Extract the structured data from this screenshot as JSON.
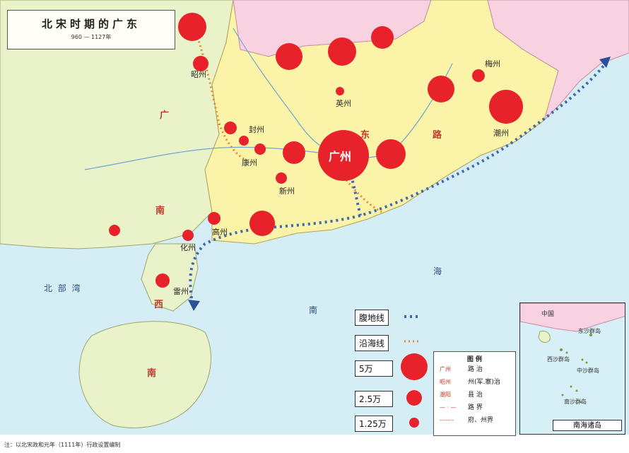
{
  "title": {
    "main": "北宋时期的广东",
    "sub": "960 — 1127年"
  },
  "note": "注：以北宋政和元年（1111年）行政设置编制",
  "keys": {
    "fudi": "腹地线",
    "yanhai": "沿海线",
    "v5": "5万",
    "v25": "2.5万",
    "v125": "1.25万"
  },
  "legend": {
    "header": "图 例",
    "rows": [
      {
        "sym": "广州",
        "label": "路 治"
      },
      {
        "sym": "昭州",
        "label": "州(军.寨)治"
      },
      {
        "sym": "潮阳",
        "label": "县 治"
      },
      {
        "sym": "— · —",
        "label": "路 界"
      },
      {
        "sym": "-------",
        "label": "府、州界"
      }
    ]
  },
  "inset": {
    "label": "南海诸岛",
    "china": "中国",
    "islands": [
      "东沙群岛",
      "西沙群岛",
      "中沙群岛",
      "南沙群岛"
    ]
  },
  "cities": [
    {
      "name": "广州",
      "big": true
    },
    {
      "name": "昭州"
    },
    {
      "name": "封州"
    },
    {
      "name": "新州"
    },
    {
      "name": "康州"
    },
    {
      "name": "雷州"
    },
    {
      "name": "化州"
    },
    {
      "name": "高州"
    },
    {
      "name": "梅州"
    },
    {
      "name": "英州"
    },
    {
      "name": "潮州"
    }
  ],
  "regions": [
    "广",
    "南",
    "东",
    "路",
    "西",
    "南"
  ],
  "seas": [
    "北 部 湾",
    "南",
    "海"
  ]
}
